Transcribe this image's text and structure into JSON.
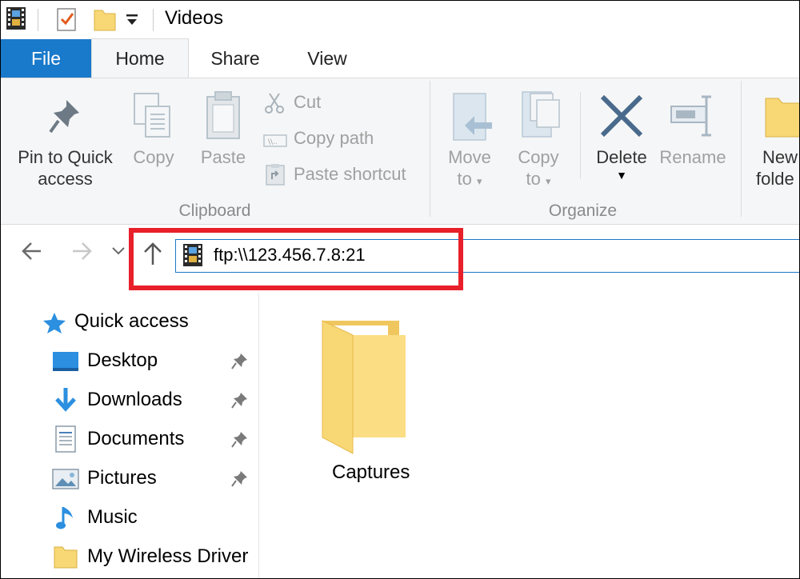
{
  "window": {
    "title": "Videos"
  },
  "tabs": [
    {
      "label": "File"
    },
    {
      "label": "Home"
    },
    {
      "label": "Share"
    },
    {
      "label": "View"
    }
  ],
  "ribbon": {
    "pin": {
      "line1": "Pin to Quick",
      "line2": "access"
    },
    "copy": "Copy",
    "paste": "Paste",
    "cut": "Cut",
    "copy_path": "Copy path",
    "paste_shortcut": "Paste shortcut",
    "clipboard_group": "Clipboard",
    "move_to": {
      "line1": "Move",
      "line2": "to"
    },
    "copy_to": {
      "line1": "Copy",
      "line2": "to"
    },
    "delete": "Delete",
    "rename": "Rename",
    "organize_group": "Organize",
    "new_folder": {
      "line1": "New",
      "line2": "folde"
    }
  },
  "address": {
    "value": "ftp:\\\\123.456.7.8:21"
  },
  "nav": {
    "quick_access": "Quick access",
    "items": [
      {
        "label": "Desktop",
        "pinned": true
      },
      {
        "label": "Downloads",
        "pinned": true
      },
      {
        "label": "Documents",
        "pinned": true
      },
      {
        "label": "Pictures",
        "pinned": true
      },
      {
        "label": "Music",
        "pinned": false
      },
      {
        "label": "My Wireless Driver",
        "pinned": false
      }
    ]
  },
  "content": {
    "items": [
      {
        "label": "Captures",
        "type": "folder"
      }
    ]
  },
  "colors": {
    "file_tab": "#1979ca",
    "ribbon_bg": "#f5f6f7",
    "highlight": "#e8202a",
    "folder": "#f8d775"
  }
}
